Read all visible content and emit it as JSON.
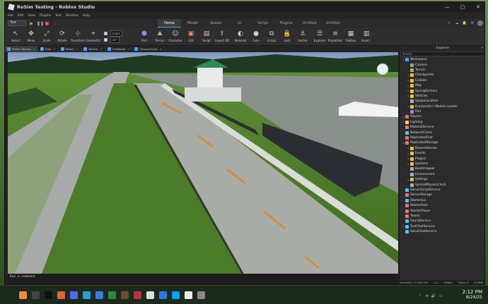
{
  "window": {
    "title": "RoSim Testing - Roblox Studio",
    "controls": [
      "—",
      "▢",
      "✕"
    ]
  },
  "menu": [
    "File",
    "Edit",
    "View",
    "Plugins",
    "Test",
    "Window",
    "Help"
  ],
  "mode_select": "Test",
  "ribbon_tabs": [
    {
      "label": "Home",
      "active": true
    },
    {
      "label": "Model",
      "active": false
    },
    {
      "label": "Avatar",
      "active": false
    },
    {
      "label": "UI",
      "active": false
    },
    {
      "label": "Script",
      "active": false
    },
    {
      "label": "Plugins",
      "active": false
    },
    {
      "label": "Untitled",
      "active": false
    },
    {
      "label": "Untitled",
      "active": false
    }
  ],
  "tools": [
    {
      "label": "Select",
      "icon": "cursor-icon",
      "glyph": "↖"
    },
    {
      "label": "Move",
      "icon": "move-icon",
      "glyph": "✥"
    },
    {
      "label": "Scale",
      "icon": "scale-icon",
      "glyph": "⤢"
    },
    {
      "label": "Rotate",
      "icon": "rotate-icon",
      "glyph": "⟳"
    },
    {
      "label": "Transform",
      "icon": "transform-icon",
      "glyph": "⊹"
    },
    {
      "label": "Geometric",
      "icon": "geometric-icon",
      "glyph": "⌖"
    }
  ],
  "snap": {
    "move_value": "0.001",
    "rotate_value": "45°"
  },
  "insert_tools": [
    {
      "label": "Part",
      "icon": "part-icon",
      "glyph": "⬢",
      "color": "#b07cff"
    },
    {
      "label": "Terrain",
      "icon": "terrain-icon",
      "glyph": "⛰",
      "color": "#9ccc65"
    },
    {
      "label": "Character",
      "icon": "character-icon",
      "glyph": "☺",
      "color": "#cfcfcf"
    },
    {
      "label": "GUI",
      "icon": "gui-icon",
      "glyph": "▣",
      "color": "#ff8a65"
    },
    {
      "label": "Script",
      "icon": "script-icon",
      "glyph": "▤",
      "color": "#cfcfcf"
    },
    {
      "label": "Import 3D",
      "icon": "import-icon",
      "glyph": "⇪",
      "color": "#cfcfcf"
    }
  ],
  "format_tools": [
    {
      "label": "Material",
      "icon": "material-icon",
      "glyph": "◐",
      "color": "#cfcfcf"
    },
    {
      "label": "Color",
      "icon": "color-icon",
      "glyph": "●",
      "color": "#cfcfcf"
    },
    {
      "label": "Group",
      "icon": "group-icon",
      "glyph": "⧉",
      "color": "#cfcfcf"
    },
    {
      "label": "Lock",
      "icon": "lock-icon",
      "glyph": "🔒",
      "color": "#cfcfcf"
    },
    {
      "label": "Anchor",
      "icon": "anchor-icon",
      "glyph": "⚓",
      "color": "#cfcfcf"
    }
  ],
  "panel_tools": [
    {
      "label": "Explorer",
      "icon": "explorer-icon",
      "glyph": "☰",
      "color": "#cfcfcf"
    },
    {
      "label": "Properties",
      "icon": "properties-icon",
      "glyph": "≡",
      "color": "#cfcfcf"
    },
    {
      "label": "Toolbox",
      "icon": "toolbox-icon",
      "glyph": "▦",
      "color": "#cfcfcf"
    },
    {
      "label": "Asset...",
      "icon": "asset-icon",
      "glyph": "▥",
      "color": "#cfcfcf"
    }
  ],
  "doc_tabs": [
    {
      "label": "RoSim Testing",
      "active": true
    },
    {
      "label": "Tune",
      "active": false
    },
    {
      "label": "Wheel",
      "active": false
    },
    {
      "label": "Vehicle",
      "active": false
    },
    {
      "label": "TireModel",
      "active": false
    },
    {
      "label": "ChassisClient",
      "active": false
    }
  ],
  "command_bar": "Run a command",
  "status": {
    "scheduler": "Scheduler: 21 kB/s 0%",
    "f1": "1.5",
    "fps": "150fps",
    "cores": "Cores: 8",
    "mem": "10.9KB"
  },
  "explorer": {
    "title": "Explorer",
    "search_placeholder": "Search",
    "items": [
      {
        "label": "Workspace",
        "depth": 0,
        "arrow": "▾",
        "color": "#4aa3ff"
      },
      {
        "label": "Camera",
        "depth": 1,
        "arrow": "",
        "color": "#9e9e9e"
      },
      {
        "label": "Terrain",
        "depth": 1,
        "arrow": "",
        "color": "#8bc34a"
      },
      {
        "label": "Checkpoints",
        "depth": 1,
        "arrow": "▸",
        "color": "#e6c04a"
      },
      {
        "label": "Collider",
        "depth": 1,
        "arrow": "▸",
        "color": "#e6c04a"
      },
      {
        "label": "Map",
        "depth": 1,
        "arrow": "▸",
        "color": "#e6c04a"
      },
      {
        "label": "SpringAnchors",
        "depth": 1,
        "arrow": "▸",
        "color": "#e6c04a"
      },
      {
        "label": "Vehicles",
        "depth": 1,
        "arrow": "▸",
        "color": "#e6c04a"
      },
      {
        "label": "SpawnLocation",
        "depth": 1,
        "arrow": "",
        "color": "#b0b0b0"
      },
      {
        "label": "Krushenfer's Module Loader",
        "depth": 1,
        "arrow": "▸",
        "color": "#e6c04a"
      },
      {
        "label": "Part",
        "depth": 1,
        "arrow": "",
        "color": "#b07cff"
      },
      {
        "label": "Players",
        "depth": 0,
        "arrow": "▸",
        "color": "#e57373"
      },
      {
        "label": "Lighting",
        "depth": 0,
        "arrow": "▸",
        "color": "#ffd54f"
      },
      {
        "label": "MaterialService",
        "depth": 0,
        "arrow": "",
        "color": "#e57373"
      },
      {
        "label": "NetworkClient",
        "depth": 0,
        "arrow": "",
        "color": "#4fc3f7"
      },
      {
        "label": "ReplicatedFirst",
        "depth": 0,
        "arrow": "",
        "color": "#e57373"
      },
      {
        "label": "ReplicatedStorage",
        "depth": 0,
        "arrow": "▾",
        "color": "#e57373"
      },
      {
        "label": "Dependencies",
        "depth": 1,
        "arrow": "▸",
        "color": "#e6c04a"
      },
      {
        "label": "Events",
        "depth": 1,
        "arrow": "▸",
        "color": "#e6c04a"
      },
      {
        "label": "Plugins",
        "depth": 1,
        "arrow": "▸",
        "color": "#e6c04a"
      },
      {
        "label": "Systems",
        "depth": 1,
        "arrow": "▸",
        "color": "#e6c04a"
      },
      {
        "label": "Bootstrapper",
        "depth": 1,
        "arrow": "",
        "color": "#b0b0b0"
      },
      {
        "label": "Environment",
        "depth": 1,
        "arrow": "",
        "color": "#b0b0b0"
      },
      {
        "label": "Settings",
        "depth": 1,
        "arrow": "▸",
        "color": "#e6c04a"
      },
      {
        "label": "SyncedPhysicsClock",
        "depth": 1,
        "arrow": "",
        "color": "#b0b0b0"
      },
      {
        "label": "ServerScriptService",
        "depth": 0,
        "arrow": "",
        "color": "#4fc3f7"
      },
      {
        "label": "ServerStorage",
        "depth": 0,
        "arrow": "",
        "color": "#e57373"
      },
      {
        "label": "StarterGui",
        "depth": 0,
        "arrow": "",
        "color": "#4fc3f7"
      },
      {
        "label": "StarterPack",
        "depth": 0,
        "arrow": "",
        "color": "#e57373"
      },
      {
        "label": "StarterPlayer",
        "depth": 0,
        "arrow": "",
        "color": "#e57373"
      },
      {
        "label": "Teams",
        "depth": 0,
        "arrow": "",
        "color": "#e57373"
      },
      {
        "label": "SoundService",
        "depth": 0,
        "arrow": "",
        "color": "#4fc3f7"
      },
      {
        "label": "TextChatService",
        "depth": 0,
        "arrow": "▸",
        "color": "#4fc3f7"
      },
      {
        "label": "VoiceChatService",
        "depth": 0,
        "arrow": "",
        "color": "#4fc3f7"
      }
    ]
  },
  "taskbar": {
    "apps": [
      {
        "icon": "start-icon",
        "color": "#f08a3c"
      },
      {
        "icon": "files-icon",
        "color": "#444"
      },
      {
        "icon": "terminal-icon",
        "color": "#111"
      },
      {
        "icon": "firefox-icon",
        "color": "#e0663a"
      },
      {
        "icon": "discord-icon",
        "color": "#5865f2"
      },
      {
        "icon": "edge-icon",
        "color": "#2a9fd6"
      },
      {
        "icon": "store-icon",
        "color": "#3a7bd5"
      },
      {
        "icon": "app-icon",
        "color": "#2b8a3e"
      },
      {
        "icon": "minecraft-icon",
        "color": "#6d4c2f"
      },
      {
        "icon": "app2-icon",
        "color": "#b34"
      },
      {
        "icon": "roblox-icon",
        "color": "#ddd"
      },
      {
        "icon": "vscode-icon",
        "color": "#2c7be5"
      },
      {
        "icon": "roblox-studio-icon",
        "color": "#00a2ff"
      },
      {
        "icon": "app3-icon",
        "color": "#eee"
      },
      {
        "icon": "app4-icon",
        "color": "#888"
      }
    ],
    "time": "2:12 PM",
    "date": "8/24/25"
  }
}
